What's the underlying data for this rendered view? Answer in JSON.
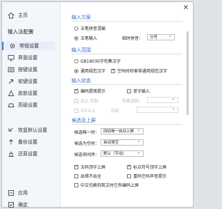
{
  "window": {
    "close_glyph": "✕"
  },
  "sidebar": {
    "home": "主页",
    "title": "输入法配置",
    "items": [
      {
        "label": "常规设置",
        "icon": "gear-icon"
      },
      {
        "label": "界面设置",
        "icon": "monitor-icon"
      },
      {
        "label": "按键设置",
        "icon": "keyboard-icon"
      },
      {
        "label": "软键设置",
        "icon": "arrow-icon"
      },
      {
        "label": "皮肤设置",
        "icon": "skin-icon"
      },
      {
        "label": "高级设置",
        "icon": "advanced-icon"
      }
    ],
    "restore": "恢复默认设置",
    "backup": "备份设置",
    "recover": "还原设置",
    "apply": "应用",
    "ok": "确定"
  },
  "input_scheme": {
    "heading": "输入方案",
    "opt1": "五笔拼音混输",
    "opt2": "五笔输入",
    "temp_label": "临时拼音：",
    "temp_value": "分号"
  },
  "input_range": {
    "heading": "输入范围",
    "opt1": "GB18030字符集汉字",
    "opt2": "通用规范汉字",
    "empty_code": "空码时检索非通用规范汉字"
  },
  "input_state": {
    "heading": "输入状态",
    "code_hint": "编码提错提示",
    "single_char": "单字输入",
    "dim_row1_a": "加上 匹配",
    "dim_row1_b": "检索调频：",
    "dim_row2_a": "4位以上",
    "dim_row2_b": "匹配"
  },
  "candidates": {
    "heading": "候选及上屏",
    "label1": "候选唯一时：",
    "value1": "四码唯一自动上屏",
    "label2": "候选为空时：",
    "value2": "自动清空",
    "label3": "候选项间序：",
    "value3": "默认（手动）",
    "cb1": "五码顶字上屏",
    "cb2": "标点符号顶字上屏",
    "cb3": "出错不出全",
    "cb4": "重码空码声音提示",
    "cb5": "中文切换到英文时已有编码上屏"
  }
}
